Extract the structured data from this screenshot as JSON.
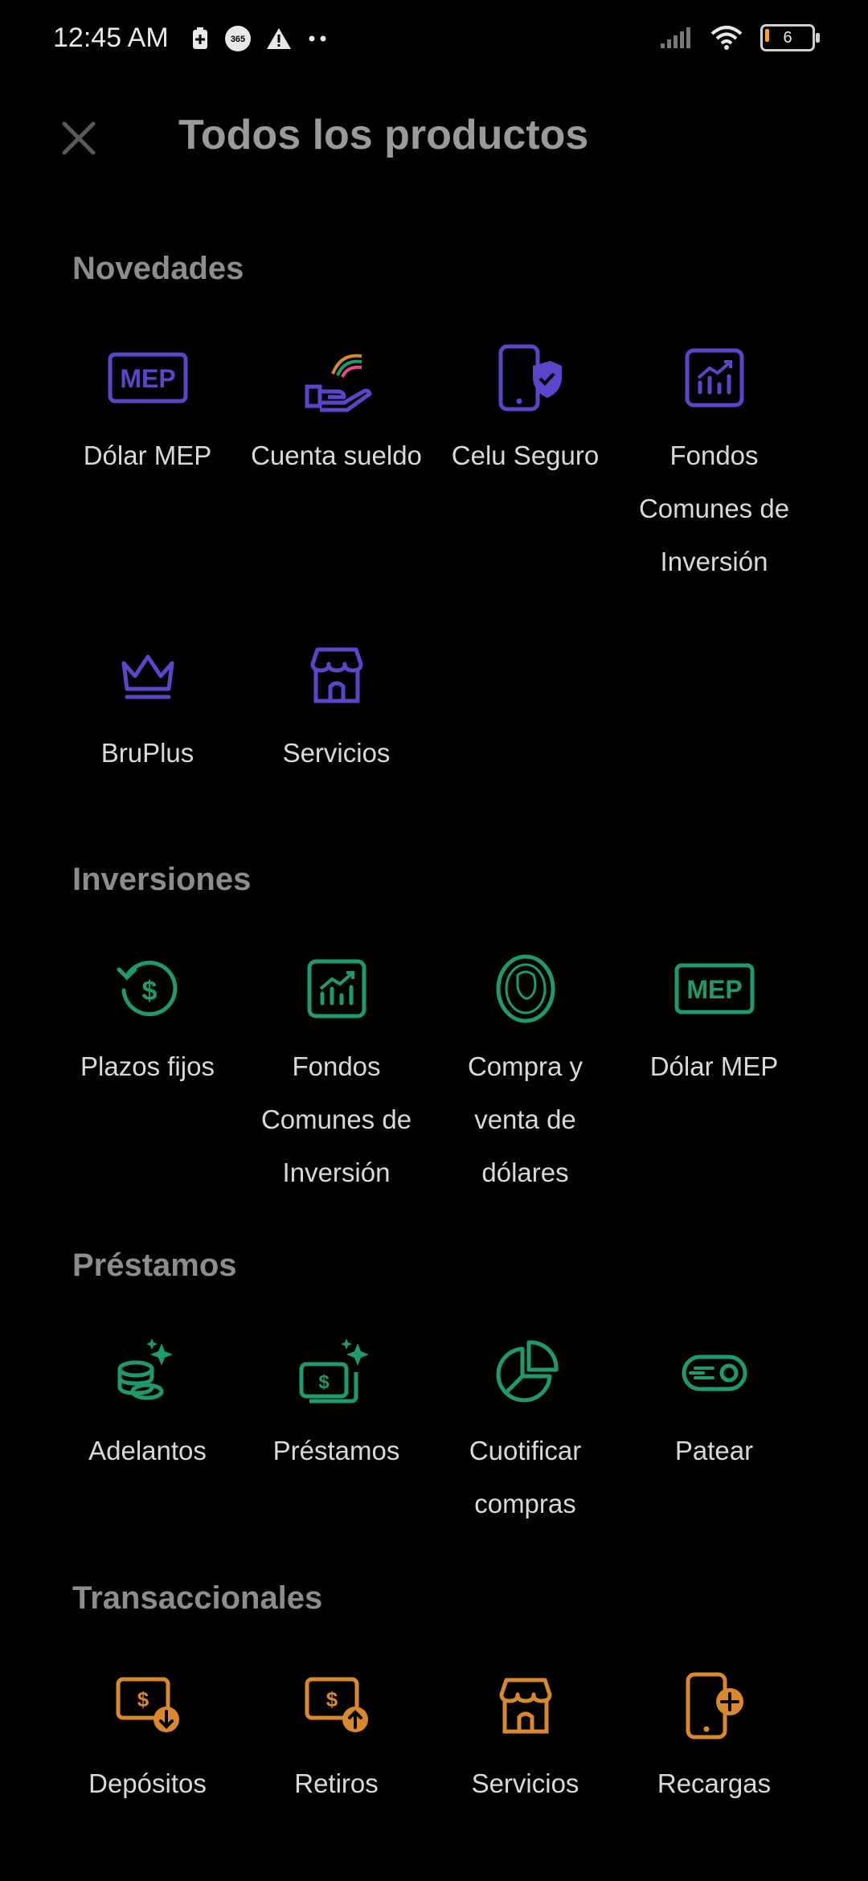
{
  "status": {
    "time": "12:45 AM",
    "battery": "6"
  },
  "header": {
    "title": "Todos los productos"
  },
  "colors": {
    "purple": "#5b46c9",
    "green": "#1f9a6a",
    "orange": "#d9882e",
    "sectionTitle": "#8d8d8d"
  },
  "sections": {
    "novedades": {
      "title": "Novedades",
      "items": [
        {
          "label": "Dólar MEP",
          "icon": "mep-icon"
        },
        {
          "label": "Cuenta sueldo",
          "icon": "rainbow-hand-icon"
        },
        {
          "label": "Celu Seguro",
          "icon": "phone-shield-icon"
        },
        {
          "label": "Fondos Comunes de Inversión",
          "icon": "chart-up-icon"
        },
        {
          "label": "BruPlus",
          "icon": "crown-icon"
        },
        {
          "label": "Servicios",
          "icon": "store-icon"
        }
      ]
    },
    "inversiones": {
      "title": "Inversiones",
      "items": [
        {
          "label": "Plazos fijos",
          "icon": "dollar-refresh-icon"
        },
        {
          "label": "Fondos Comunes de Inversión",
          "icon": "chart-up-icon"
        },
        {
          "label": "Compra y venta de dólares",
          "icon": "dollar-face-icon"
        },
        {
          "label": "Dólar MEP",
          "icon": "mep-icon"
        }
      ]
    },
    "prestamos": {
      "title": "Préstamos",
      "items": [
        {
          "label": "Adelantos",
          "icon": "coins-sparkle-icon"
        },
        {
          "label": "Préstamos",
          "icon": "money-sparkle-icon"
        },
        {
          "label": "Cuotificar compras",
          "icon": "pie-chart-icon"
        },
        {
          "label": "Patear",
          "icon": "fast-toggle-icon"
        }
      ]
    },
    "transaccionales": {
      "title": "Transaccionales",
      "items": [
        {
          "label": "Depósitos",
          "icon": "money-down-icon"
        },
        {
          "label": "Retiros",
          "icon": "money-up-icon"
        },
        {
          "label": "Servicios",
          "icon": "store-icon"
        },
        {
          "label": "Recargas",
          "icon": "phone-plus-icon"
        }
      ]
    }
  }
}
